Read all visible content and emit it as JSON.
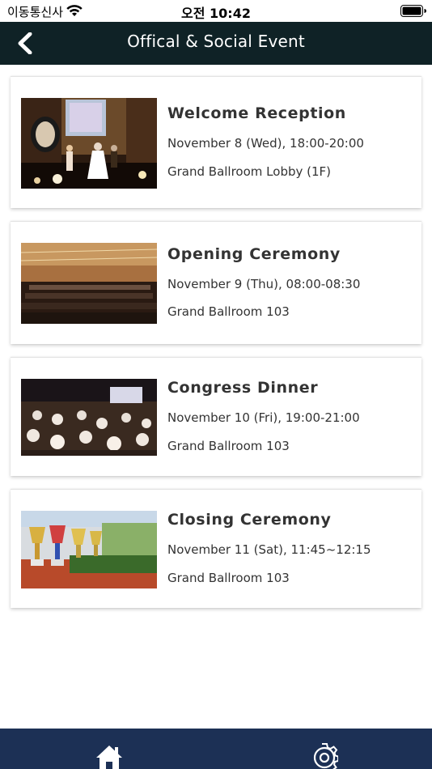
{
  "status_bar": {
    "carrier": "이동통신사",
    "time": "오전 10:42",
    "icons": [
      "wifi-icon",
      "battery-icon"
    ]
  },
  "nav": {
    "title": "Offical & Social Event",
    "back_icon": "chevron-left-icon"
  },
  "events": [
    {
      "title": "Welcome Reception",
      "date": "November 8 (Wed), 18:00-20:00",
      "venue": "Grand Ballroom Lobby (1F)",
      "image": "reception-stage-photo"
    },
    {
      "title": "Opening Ceremony",
      "date": "November 9 (Thu), 08:00-08:30",
      "venue": "Grand Ballroom 103",
      "image": "conference-hall-photo"
    },
    {
      "title": "Congress Dinner",
      "date": "November 10 (Fri), 19:00-21:00",
      "venue": "Grand Ballroom 103",
      "image": "banquet-hall-photo"
    },
    {
      "title": "Closing Ceremony",
      "date": "November 11 (Sat), 11:45~12:15",
      "venue": "Grand Ballroom 103",
      "image": "trophies-photo"
    }
  ],
  "tab_bar": {
    "items": [
      "home-icon",
      "gear-icon"
    ],
    "colors": {
      "background": "#1c3055",
      "icon": "#ffffff"
    }
  },
  "colors": {
    "nav_background": "#0f2226",
    "text": "#333333",
    "card_background": "#ffffff"
  }
}
